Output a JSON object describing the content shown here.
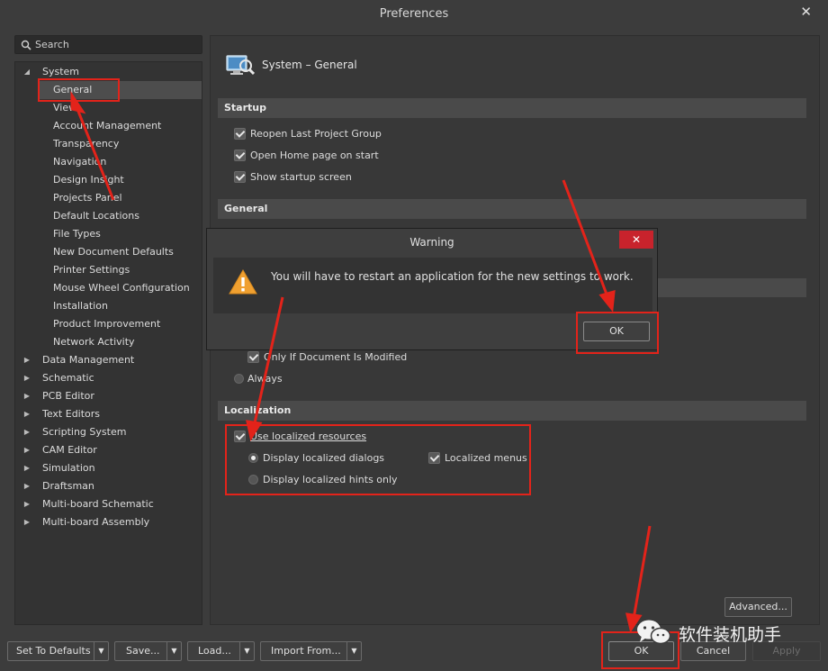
{
  "window": {
    "title": "Preferences",
    "close_glyph": "✕"
  },
  "search": {
    "placeholder": "Search"
  },
  "tree": {
    "system": {
      "label": "System",
      "children": [
        "General",
        "View",
        "Account Management",
        "Transparency",
        "Navigation",
        "Design Insight",
        "Projects Panel",
        "Default Locations",
        "File Types",
        "New Document Defaults",
        "Printer Settings",
        "Mouse Wheel Configuration",
        "Installation",
        "Product Improvement",
        "Network Activity"
      ]
    },
    "categories": [
      "Data Management",
      "Schematic",
      "PCB Editor",
      "Text Editors",
      "Scripting System",
      "CAM Editor",
      "Simulation",
      "Draftsman",
      "Multi-board Schematic",
      "Multi-board Assembly"
    ]
  },
  "page": {
    "title": "System – General",
    "startup": {
      "header": "Startup",
      "options": [
        "Reopen Last Project Group",
        "Open Home page on start",
        "Show startup screen"
      ]
    },
    "general": {
      "header": "General"
    },
    "save": {
      "only_if_modified": "Only If Document Is Modified",
      "always": "Always"
    },
    "localization": {
      "header": "Localization",
      "use_localized": "Use localized resources",
      "display_dialogs": "Display localized dialogs",
      "display_hints": "Display localized hints only",
      "localized_menus": "Localized menus"
    },
    "advanced_button": "Advanced..."
  },
  "dialog": {
    "title": "Warning",
    "close_glyph": "✕",
    "message": "You will have to restart an application for the new settings to work.",
    "ok": "OK"
  },
  "footer": {
    "set_defaults": "Set To Defaults",
    "save": "Save...",
    "load": "Load...",
    "import_from": "Import From...",
    "ok": "OK",
    "cancel": "Cancel",
    "apply": "Apply"
  },
  "watermark": {
    "text": "软件装机助手"
  },
  "colors": {
    "annotation_red": "#e3231a",
    "dialog_close_red": "#c8232c",
    "warning_orange": "#f0a030"
  }
}
